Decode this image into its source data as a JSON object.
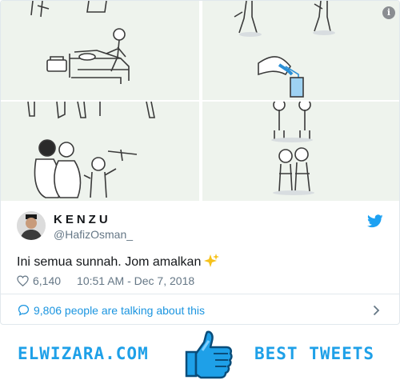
{
  "tweet": {
    "display_name": "KENZU",
    "handle": "@HafizOsman_",
    "text": "Ini semua sunnah. Jom amalkan",
    "likes": "6,140",
    "timestamp": "10:51 AM - Dec 7, 2018",
    "talking": "9,806 people are talking about this",
    "info_glyph": "i"
  },
  "banner": {
    "left_text": "ELWIZARA.COM",
    "right_text": "BEST TWEETS"
  },
  "colors": {
    "twitter_blue": "#1da1f2",
    "link_blue": "#1b95e0",
    "muted": "#657786",
    "brand_blue": "#1ea0e8"
  },
  "icons": [
    "info-icon",
    "twitter-bird-icon",
    "sparkles-icon",
    "heart-icon",
    "speech-bubble-icon",
    "chevron-right-icon",
    "thumbs-up-icon"
  ]
}
